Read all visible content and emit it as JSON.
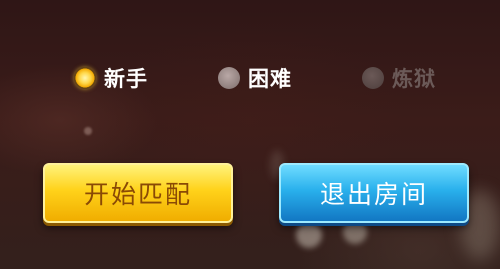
{
  "difficulty": {
    "selected": "新手",
    "options": [
      {
        "label": "新手",
        "state": "selected"
      },
      {
        "label": "困难",
        "state": "normal"
      },
      {
        "label": "炼狱",
        "state": "disabled"
      }
    ]
  },
  "buttons": {
    "start_match_label": "开始匹配",
    "exit_room_label": "退出房间"
  },
  "colors": {
    "selected_radio": "#ffd84a",
    "start_button": "#ffd21a",
    "exit_button": "#29b0ec",
    "disabled_text": "#6b5a58"
  }
}
